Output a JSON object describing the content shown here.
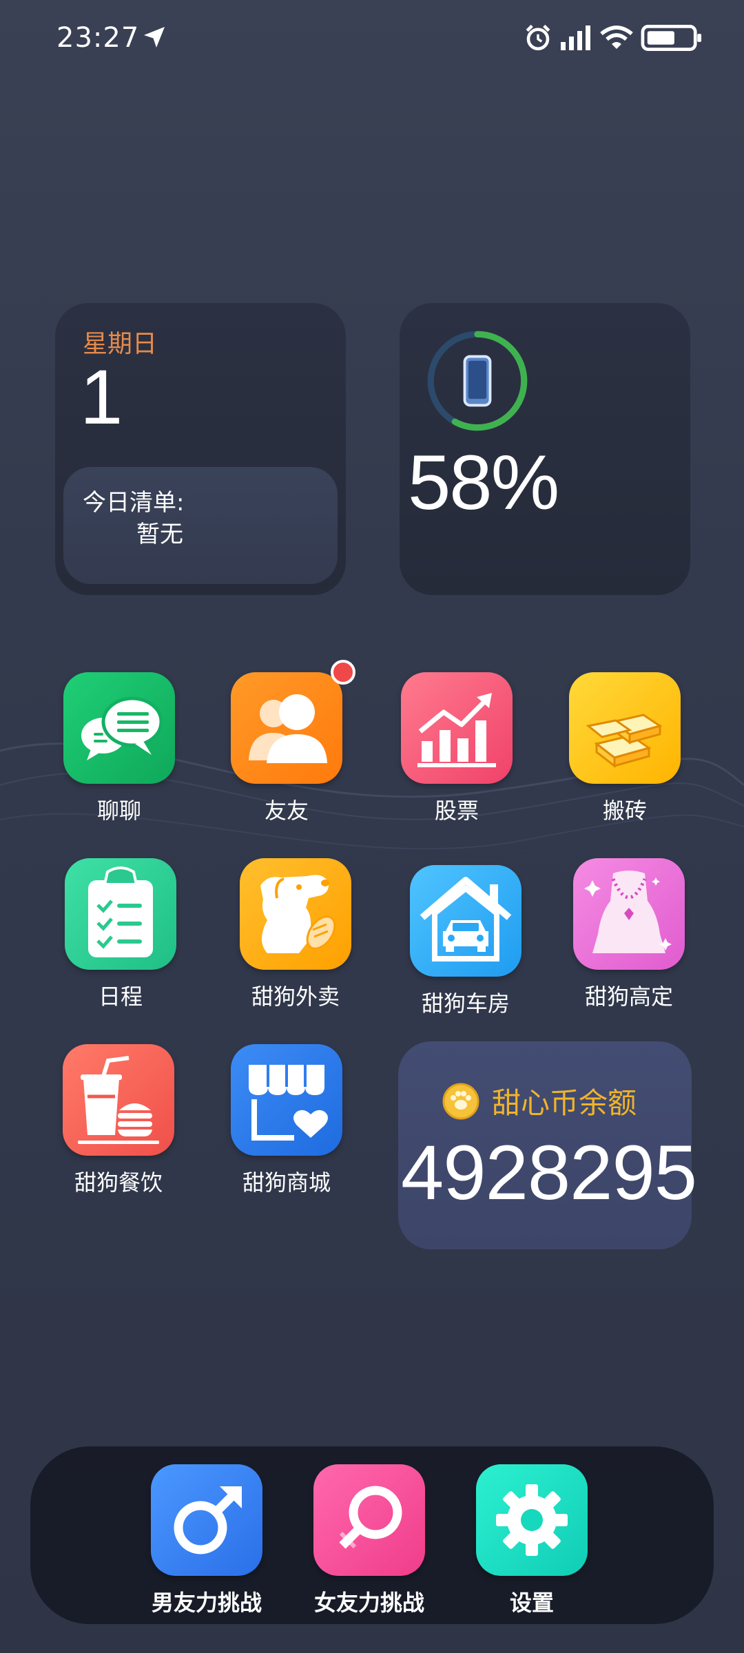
{
  "status_bar": {
    "time": "23:27",
    "icons": [
      "location-arrow-icon",
      "alarm-icon",
      "signal-icon",
      "wifi-icon",
      "battery-icon"
    ]
  },
  "date_widget": {
    "weekday": "星期日",
    "day": "1",
    "todo_title": "今日清单:",
    "todo_value": "暂无"
  },
  "battery_widget": {
    "percent_text": "58%",
    "level": 0.58,
    "ring_color": "#3fb24f"
  },
  "apps": [
    {
      "label": "聊聊",
      "icon": "chat-bubbles-icon",
      "color": "#16b866"
    },
    {
      "label": "友友",
      "icon": "contacts-icon",
      "color": "#ff8a1c",
      "badge": true
    },
    {
      "label": "股票",
      "icon": "stock-chart-icon",
      "color": "#ff5c7a"
    },
    {
      "label": "搬砖",
      "icon": "gold-bars-icon",
      "color": "#ffc21a"
    },
    {
      "label": "日程",
      "icon": "clipboard-checklist-icon",
      "color": "#2dcf92"
    },
    {
      "label": "甜狗外卖",
      "icon": "dog-food-icon",
      "color": "#ffb21f"
    },
    {
      "label": "甜狗车房",
      "icon": "house-car-icon",
      "color": "#39b8ff"
    },
    {
      "label": "甜狗高定",
      "icon": "necklace-icon",
      "color": "#f06fd6"
    },
    {
      "label": "甜狗餐饮",
      "icon": "drink-burger-icon",
      "color": "#ff6b5a"
    },
    {
      "label": "甜狗商城",
      "icon": "store-heart-icon",
      "color": "#2f7cf0"
    }
  ],
  "coin_card": {
    "title": "甜心币余额",
    "value": "4928295",
    "icon": "paw-coin-icon",
    "title_color": "#f0b429"
  },
  "dock": [
    {
      "label": "男友力挑战",
      "icon": "male-symbol-icon",
      "color": "#3f86f5"
    },
    {
      "label": "女友力挑战",
      "icon": "female-symbol-icon",
      "color": "#ff4f9a"
    },
    {
      "label": "设置",
      "icon": "gear-icon",
      "color": "#19dfc4"
    }
  ]
}
